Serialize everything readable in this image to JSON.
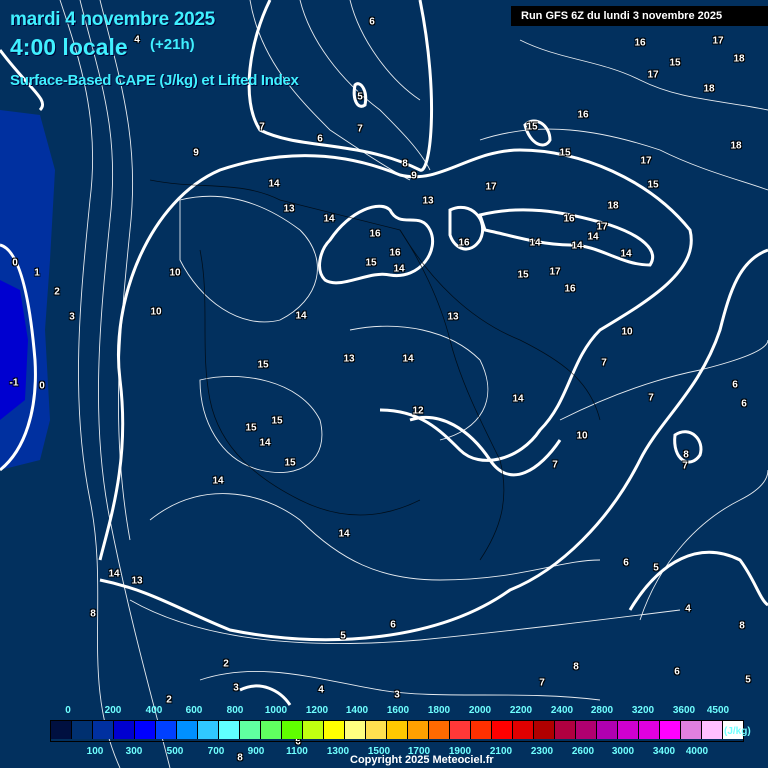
{
  "header": {
    "date": "mardi 4 novembre 2025",
    "time": "4:00 locale",
    "offset": "(+21h)",
    "parameter": "Surface-Based CAPE (J/kg) et Lifted Index",
    "run": "Run GFS 6Z du lundi 3 novembre 2025"
  },
  "legend": {
    "unit": "(J/kg)",
    "colors": [
      "#001040",
      "#003070",
      "#0030a0",
      "#0000d0",
      "#0000ff",
      "#0040ff",
      "#0090ff",
      "#30c8ff",
      "#60ffff",
      "#60ffa0",
      "#60ff60",
      "#60ff00",
      "#c0ff10",
      "#ffff00",
      "#ffff80",
      "#ffe050",
      "#ffc800",
      "#ffa000",
      "#ff6a00",
      "#ff3838",
      "#ff3000",
      "#ff0000",
      "#e00000",
      "#b00000",
      "#b00040",
      "#b00070",
      "#b000b0",
      "#d000d0",
      "#e000e0",
      "#ff00ff",
      "#e080e0",
      "#ffc0ff",
      "#ffffff"
    ],
    "top_labels": [
      "0",
      "200",
      "400",
      "600",
      "800",
      "1000",
      "1200",
      "1400",
      "1600",
      "1800",
      "2000",
      "2200",
      "2400",
      "2800",
      "3200",
      "3600",
      "4500"
    ],
    "bottom_labels": [
      "100",
      "300",
      "500",
      "700",
      "900",
      "1100",
      "1300",
      "1500",
      "1700",
      "1900",
      "2100",
      "2300",
      "2600",
      "3000",
      "3400",
      "4000"
    ]
  },
  "copyright": "Copyright 2025 Meteociel.fr",
  "map": {
    "background": "#02305e",
    "contour_color": "#ffffff",
    "lifted_index_labels": [
      "6",
      "4",
      "5",
      "7",
      "6",
      "7",
      "9",
      "8",
      "9",
      "13",
      "14",
      "13",
      "14",
      "16",
      "15",
      "16",
      "14",
      "16",
      "14",
      "17",
      "16",
      "14",
      "14",
      "15",
      "14",
      "17",
      "15",
      "16",
      "16",
      "18",
      "17",
      "15",
      "15",
      "16",
      "18",
      "17",
      "17",
      "18",
      "18",
      "15",
      "17",
      "0",
      "1",
      "2",
      "3",
      "-1",
      "0",
      "10",
      "10",
      "14",
      "13",
      "14",
      "15",
      "13",
      "15",
      "15",
      "14",
      "15",
      "14",
      "12",
      "14",
      "10",
      "7",
      "7",
      "6",
      "6",
      "10",
      "8",
      "7",
      "14",
      "6",
      "5",
      "4",
      "13",
      "14",
      "8",
      "5",
      "6",
      "2",
      "2",
      "3",
      "4",
      "3",
      "6",
      "8",
      "8",
      "7",
      "6",
      "5",
      "6",
      "8",
      "7"
    ]
  }
}
